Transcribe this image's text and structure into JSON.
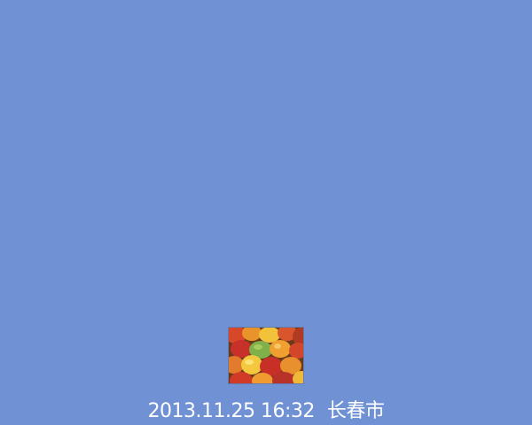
{
  "background_color": "#7092d4",
  "photo": {
    "subject_icon": "mango-fruit-photo"
  },
  "caption": {
    "datetime": "2013.11.25 16:32",
    "location": "长春市"
  }
}
